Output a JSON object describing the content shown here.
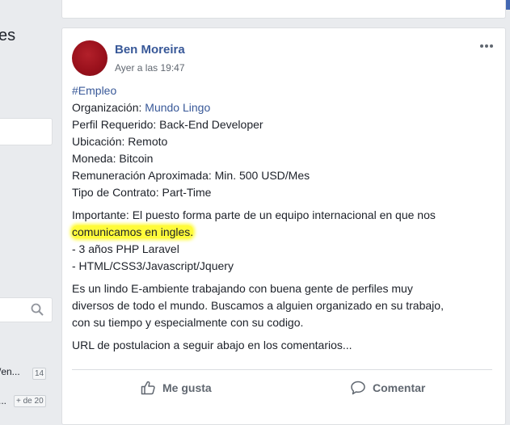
{
  "left_column": {
    "title_fragment": "es",
    "row1_text": "/en...",
    "row1_badge": "14",
    "row2_text": "...",
    "row2_badge": "+ de 20"
  },
  "post": {
    "author": "Ben Moreira",
    "time": "Ayer a las 19:47",
    "hashtag": "#Empleo",
    "org_label": "Organización: ",
    "org_value": "Mundo Lingo",
    "lines1": [
      "Perfil Requerido: Back-End Developer",
      "Ubicación: Remoto",
      "Moneda: Bitcoin",
      "Remuneración Aproximada: Min. 500 USD/Mes",
      "Tipo de Contrato: Part-Time"
    ],
    "important_line1": "Importante: El puesto forma parte de un equipo internacional en que nos",
    "important_highlight": "comunicamos en ingles.",
    "reqs": [
      "- 3 años PHP Laravel",
      "- HTML/CSS3/Javascript/Jquery"
    ],
    "para3": [
      "Es un lindo E-ambiente trabajando con buena gente de perfiles muy",
      "diversos de todo el mundo. Buscamos a alguien organizado en su trabajo,",
      "con su tiempo y especialmente con su codigo."
    ],
    "para4": "URL de postulacion a seguir abajo en los comentarios...",
    "like_label": "Me gusta",
    "comment_label": "Comentar"
  },
  "colors": {
    "link": "#385898",
    "highlight": "#fffb3a",
    "topbar": "#4267b2"
  },
  "icons": [
    "search-icon",
    "more-options-icon",
    "like-icon",
    "comment-icon"
  ]
}
